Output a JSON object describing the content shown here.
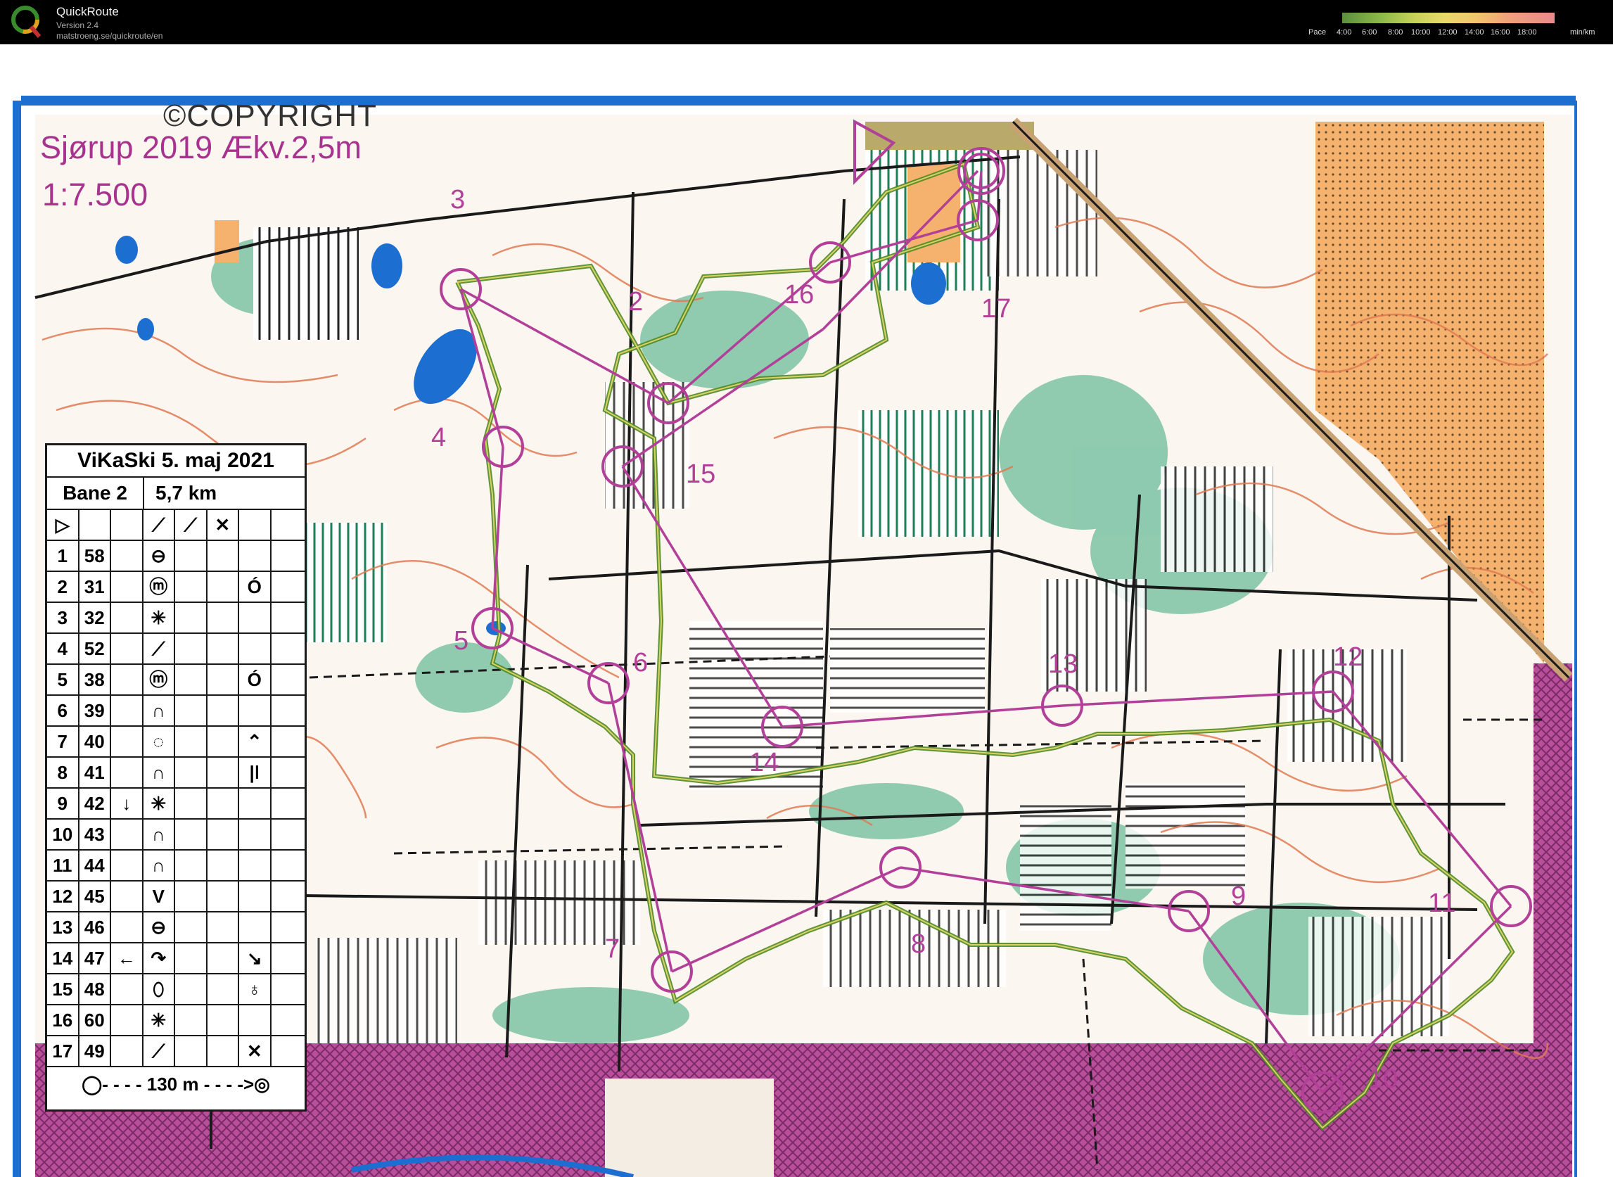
{
  "app": {
    "name": "QuickRoute",
    "version": "Version 2.4",
    "url": "matstroeng.se/quickroute/en"
  },
  "pace_legend": {
    "label": "Pace",
    "ticks": [
      "4:00",
      "6:00",
      "8:00",
      "10:00",
      "12:00",
      "14:00",
      "16:00",
      "18:00"
    ],
    "unit": "min/km"
  },
  "map": {
    "title": "Sjørup 2019 Ækv.2,5m",
    "scale": "1:7.500",
    "copyright": "©COPYRIGHT",
    "course_color": "#b23f98",
    "route_color": "#7ba23a",
    "controls": [
      {
        "label": "3"
      },
      {
        "label": "2"
      },
      {
        "label": "16"
      },
      {
        "label": "17"
      },
      {
        "label": "4"
      },
      {
        "label": "15"
      },
      {
        "label": "5"
      },
      {
        "label": "6"
      },
      {
        "label": "13"
      },
      {
        "label": "12"
      },
      {
        "label": "14"
      },
      {
        "label": "9"
      },
      {
        "label": "11"
      },
      {
        "label": "8"
      },
      {
        "label": "7"
      },
      {
        "label": "10"
      }
    ]
  },
  "description": {
    "title": "ViKaSki 5. maj 2021",
    "course": "Bane 2",
    "length": "5,7 km",
    "rows": [
      {
        "n": "1",
        "code": "58",
        "dir": "",
        "sym": "⊖",
        "extra": ""
      },
      {
        "n": "2",
        "code": "31",
        "dir": "",
        "sym": "ⓜ",
        "extra": "Ó"
      },
      {
        "n": "3",
        "code": "32",
        "dir": "",
        "sym": "✳",
        "extra": ""
      },
      {
        "n": "4",
        "code": "52",
        "dir": "",
        "sym": "⟋",
        "extra": ""
      },
      {
        "n": "5",
        "code": "38",
        "dir": "",
        "sym": "ⓜ",
        "extra": "Ó"
      },
      {
        "n": "6",
        "code": "39",
        "dir": "",
        "sym": "∩",
        "extra": ""
      },
      {
        "n": "7",
        "code": "40",
        "dir": "",
        "sym": "◌",
        "extra": "⌃"
      },
      {
        "n": "8",
        "code": "41",
        "dir": "",
        "sym": "∩",
        "extra": "|ǀ"
      },
      {
        "n": "9",
        "code": "42",
        "dir": "↓",
        "sym": "✳",
        "extra": ""
      },
      {
        "n": "10",
        "code": "43",
        "dir": "",
        "sym": "∩",
        "extra": ""
      },
      {
        "n": "11",
        "code": "44",
        "dir": "",
        "sym": "∩",
        "extra": ""
      },
      {
        "n": "12",
        "code": "45",
        "dir": "",
        "sym": "V",
        "extra": ""
      },
      {
        "n": "13",
        "code": "46",
        "dir": "",
        "sym": "⊖",
        "extra": ""
      },
      {
        "n": "14",
        "code": "47",
        "dir": "←",
        "sym": "↷",
        "extra": "↘"
      },
      {
        "n": "15",
        "code": "48",
        "dir": "",
        "sym": "⬯",
        "extra": "♁"
      },
      {
        "n": "16",
        "code": "60",
        "dir": "",
        "sym": "✳",
        "extra": ""
      },
      {
        "n": "17",
        "code": "49",
        "dir": "",
        "sym": "⟋",
        "extra": "✕"
      }
    ],
    "footer": "130 m"
  }
}
